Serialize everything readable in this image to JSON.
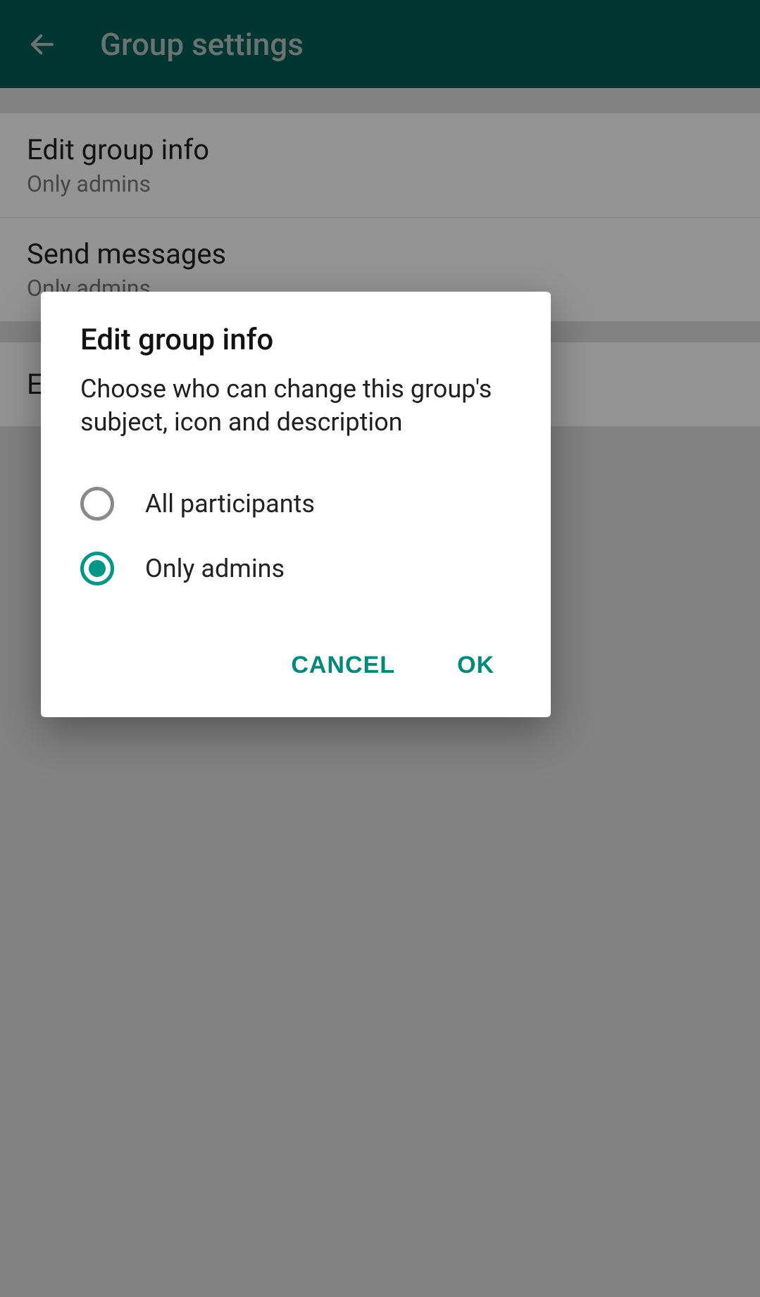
{
  "appbar": {
    "title": "Group settings"
  },
  "settings": [
    {
      "title": "Edit group info",
      "value": "Only admins"
    },
    {
      "title": "Send messages",
      "value": "Only admins"
    }
  ],
  "edit_admins_label": "Edit group admins",
  "dialog": {
    "title": "Edit group info",
    "description": "Choose who can change this group's subject, icon and description",
    "options": [
      {
        "label": "All participants",
        "selected": false
      },
      {
        "label": "Only admins",
        "selected": true
      }
    ],
    "cancel": "CANCEL",
    "ok": "OK"
  },
  "colors": {
    "accent": "#009688",
    "appbar": "#005e55"
  }
}
